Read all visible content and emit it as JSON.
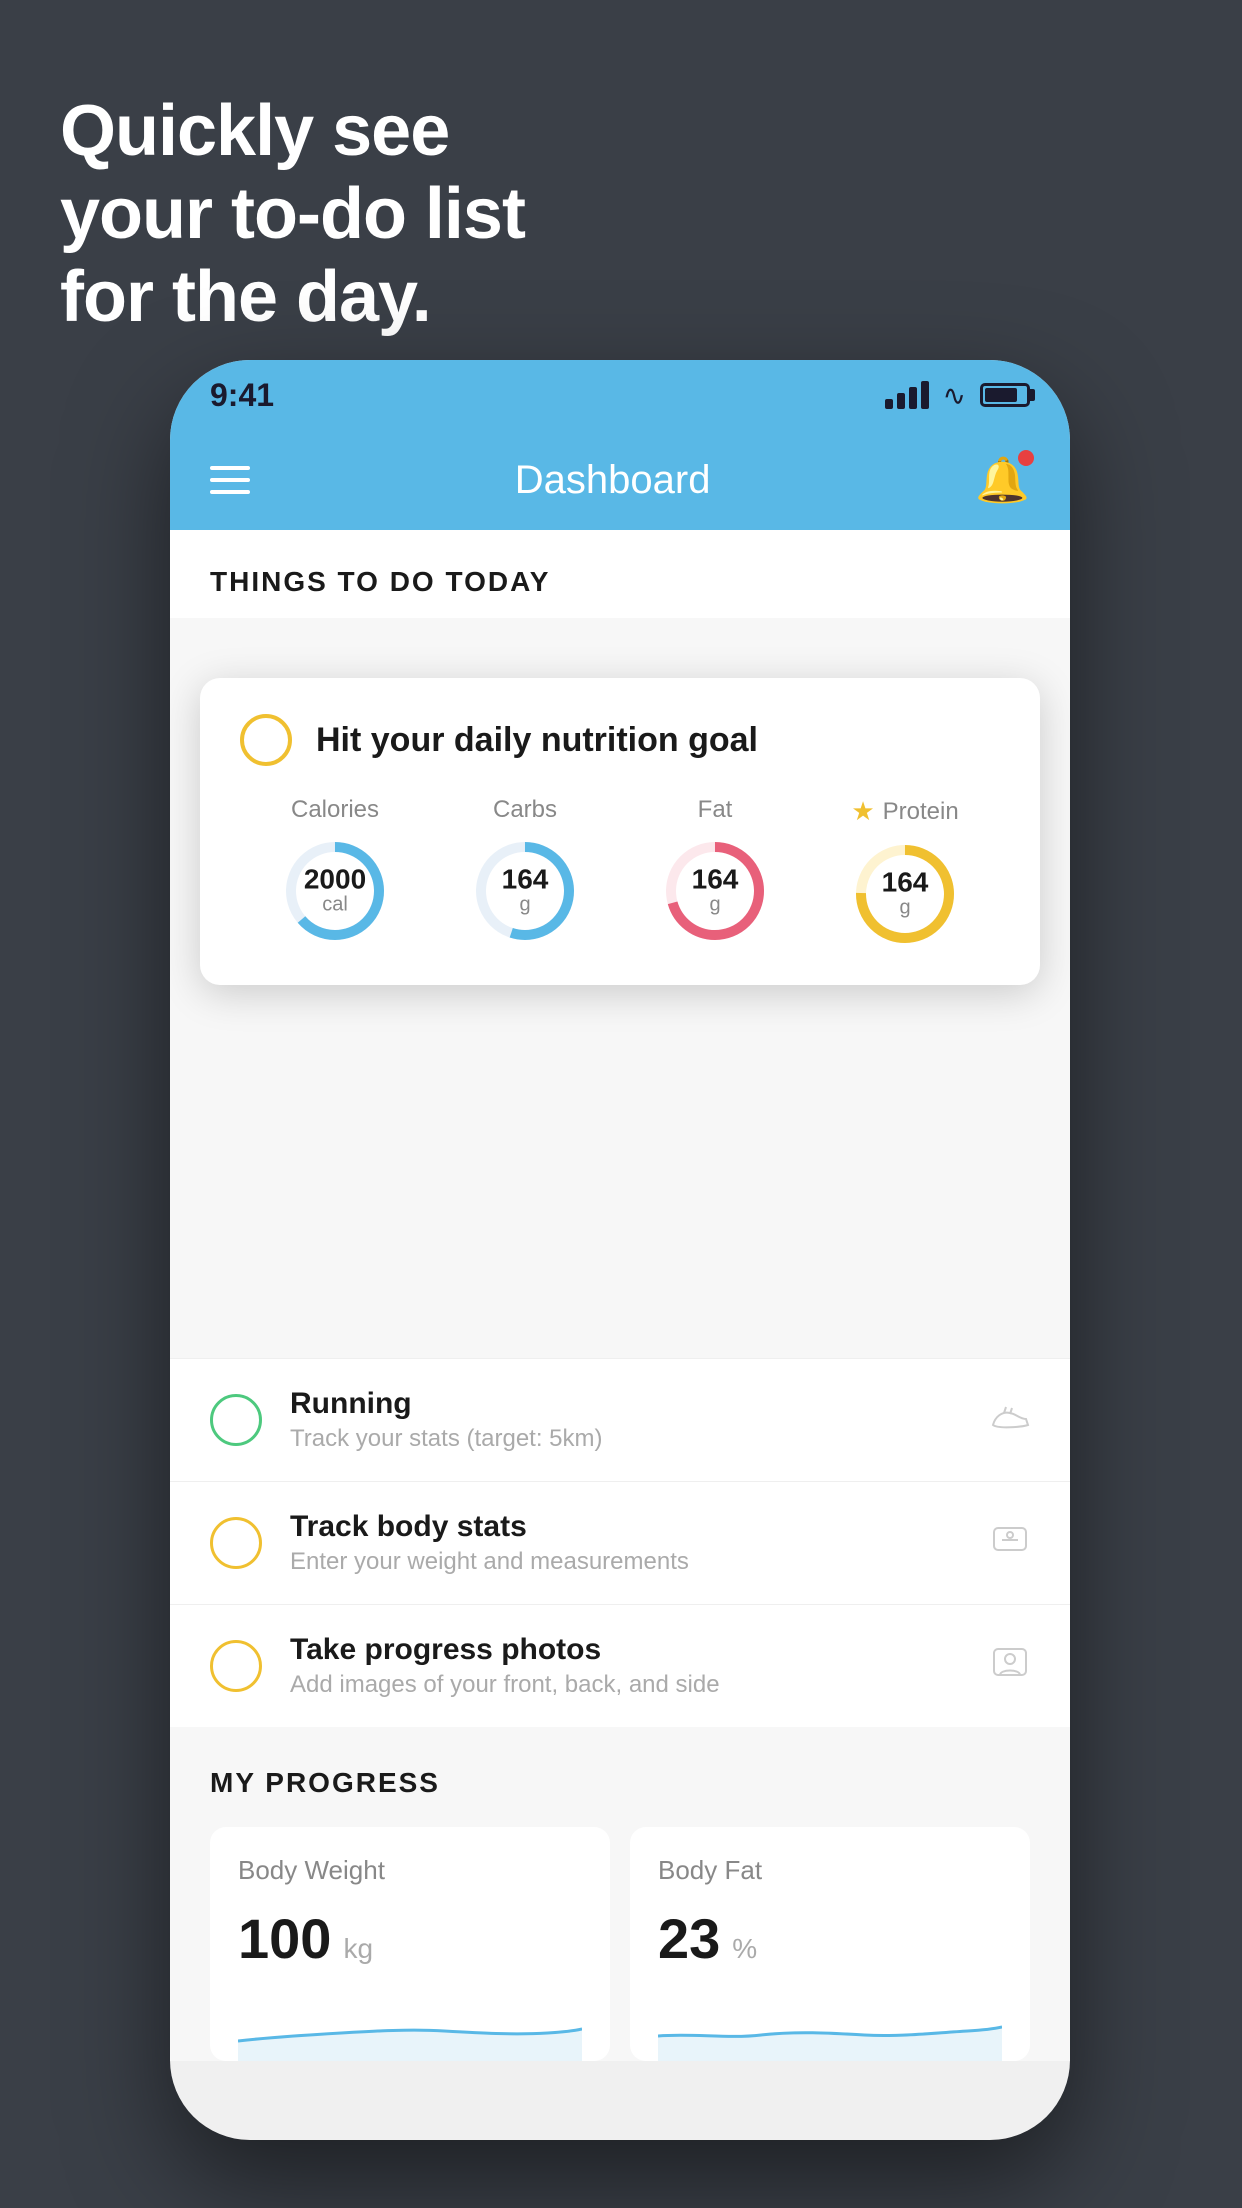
{
  "hero": {
    "line1": "Quickly see",
    "line2": "your to-do list",
    "line3": "for the day."
  },
  "statusBar": {
    "time": "9:41"
  },
  "header": {
    "title": "Dashboard"
  },
  "thingsToDo": {
    "sectionTitle": "THINGS TO DO TODAY"
  },
  "nutritionCard": {
    "title": "Hit your daily nutrition goal",
    "calories": {
      "label": "Calories",
      "value": "2000",
      "unit": "cal",
      "color": "#59b8e6",
      "percent": 65
    },
    "carbs": {
      "label": "Carbs",
      "value": "164",
      "unit": "g",
      "color": "#59b8e6",
      "percent": 55
    },
    "fat": {
      "label": "Fat",
      "value": "164",
      "unit": "g",
      "color": "#e8607a",
      "percent": 70
    },
    "protein": {
      "label": "Protein",
      "value": "164",
      "unit": "g",
      "color": "#f0c030",
      "percent": 75
    }
  },
  "todoItems": [
    {
      "title": "Running",
      "subtitle": "Track your stats (target: 5km)",
      "checkColor": "green",
      "icon": "shoe"
    },
    {
      "title": "Track body stats",
      "subtitle": "Enter your weight and measurements",
      "checkColor": "yellow",
      "icon": "scale"
    },
    {
      "title": "Take progress photos",
      "subtitle": "Add images of your front, back, and side",
      "checkColor": "yellow",
      "icon": "person"
    }
  ],
  "progress": {
    "sectionTitle": "MY PROGRESS",
    "bodyWeight": {
      "label": "Body Weight",
      "value": "100",
      "unit": "kg"
    },
    "bodyFat": {
      "label": "Body Fat",
      "value": "23",
      "unit": "%"
    }
  }
}
